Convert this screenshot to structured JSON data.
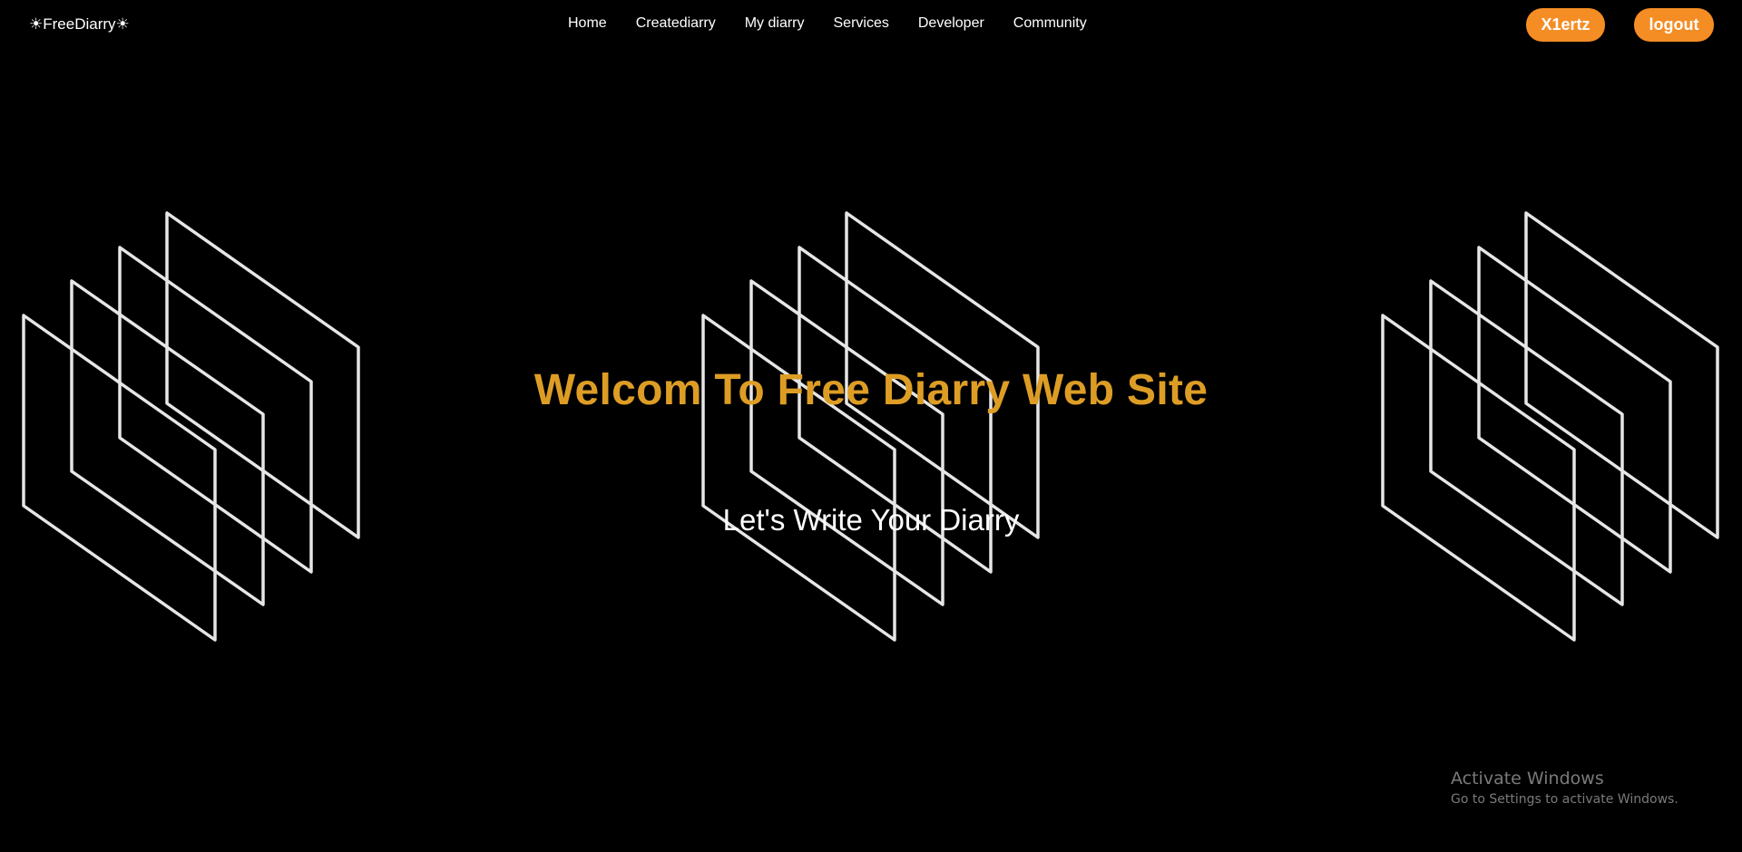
{
  "navbar": {
    "brand": "☀FreeDiarry☀",
    "links": [
      {
        "label": "Home"
      },
      {
        "label": "Creatediarry"
      },
      {
        "label": "My diarry"
      },
      {
        "label": "Services"
      },
      {
        "label": "Developer"
      },
      {
        "label": "Community"
      }
    ],
    "user_button": "X1ertz",
    "logout_button": "logout",
    "accent_color": "#f58d25"
  },
  "hero": {
    "title": "Welcom To Free Diarry Web Site",
    "subtitle": "Let's Write Your Diarry",
    "title_color": "#dd9d25"
  },
  "watermark": {
    "title": "Activate Windows",
    "subtitle": "Go to Settings to activate Windows."
  },
  "icons": [
    "sun-icon"
  ]
}
